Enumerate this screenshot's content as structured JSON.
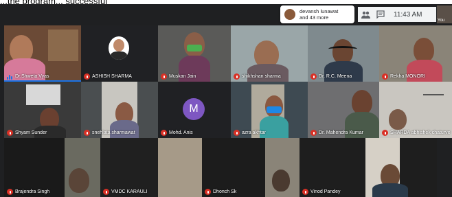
{
  "caption_partial": "...the program... successful",
  "notification": {
    "name": "devansh lunawat",
    "more": "and 43 more"
  },
  "topbar": {
    "time": "11:43 AM",
    "self_label": "You",
    "icons": [
      "people-icon",
      "chat-icon"
    ]
  },
  "tiles": [
    {
      "name": "Dr.Shweta Vyas",
      "speaking": true
    },
    {
      "name": "ASHISH SHARMA"
    },
    {
      "name": "Muskan Jain"
    },
    {
      "name": "shikhshan sharma"
    },
    {
      "name": "Dr. R.C. Meena"
    },
    {
      "name": "Rekha MONORI"
    },
    {
      "name": "Shyam Sunder"
    },
    {
      "name": "snehlata sharmawat"
    },
    {
      "name": "Mohd. Anis",
      "avatar_letter": "M"
    },
    {
      "name": "azra akhtar"
    },
    {
      "name": "Dr. Mahendra Kumar"
    },
    {
      "name": "SHARDA abhishek chaturve"
    },
    {
      "name": "Brajendra Singh"
    },
    {
      "name": "VMDC KARAULI"
    },
    {
      "name": "Dhonch Sk"
    },
    {
      "name": "Vinod Pandey"
    }
  ],
  "colors": {
    "mic_muted": "#d93025",
    "accent": "#1a73e8",
    "avatar_m": "#7e57c2"
  }
}
